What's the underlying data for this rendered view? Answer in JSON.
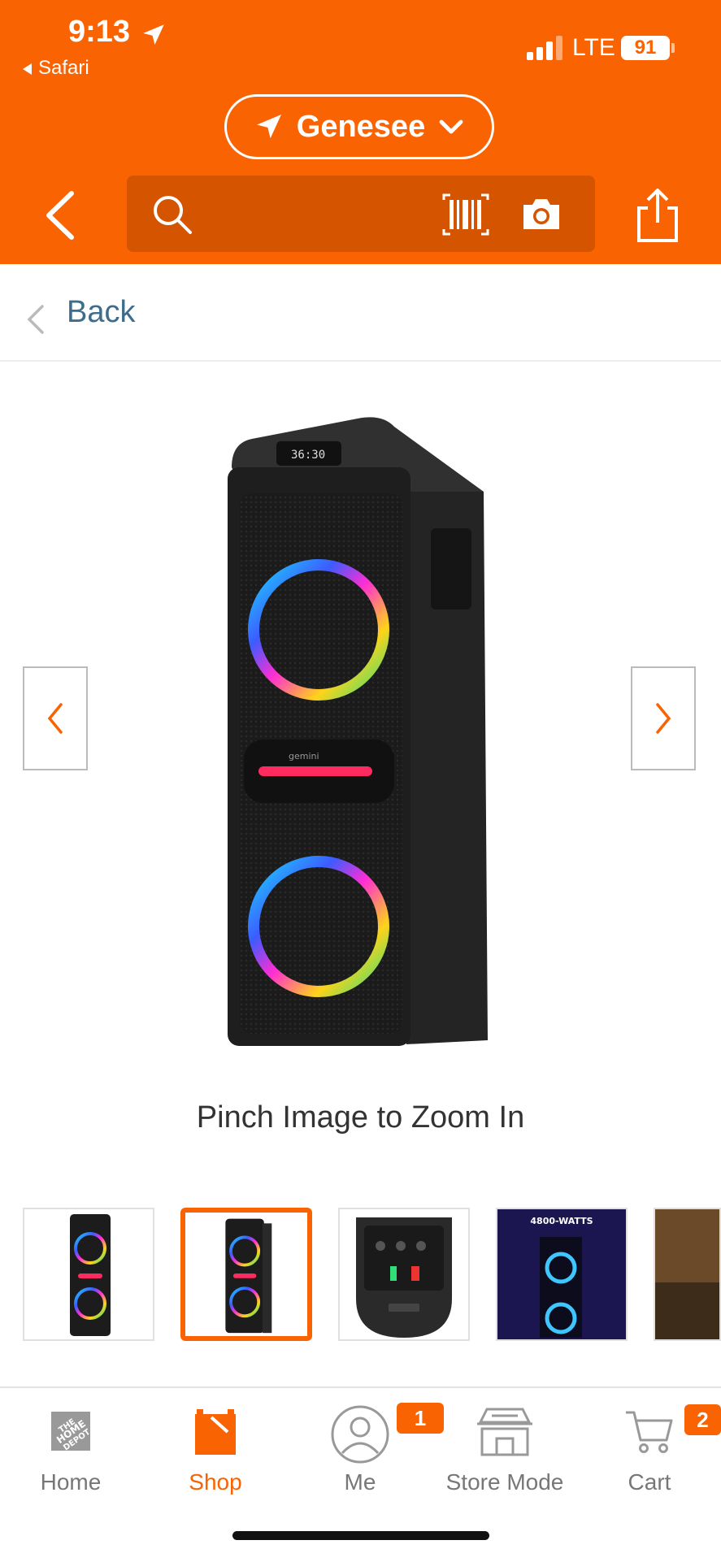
{
  "status_bar": {
    "time": "9:13",
    "back_app": "Safari",
    "network": "LTE",
    "battery": "91"
  },
  "header": {
    "store_name": "Genesee"
  },
  "backbar": {
    "label": "Back"
  },
  "gallery": {
    "hint": "Pinch Image to Zoom In",
    "active_thumbnail_index": 1,
    "thumbnail_count": 5
  },
  "thumbnails": [
    {
      "overlay_text": ""
    },
    {
      "overlay_text": ""
    },
    {
      "overlay_text": ""
    },
    {
      "overlay_text": "4800-WATTS"
    },
    {
      "overlay_text": ""
    }
  ],
  "tabbar": {
    "tabs": [
      {
        "label": "Home",
        "icon": "home-depot-logo-icon",
        "active": false
      },
      {
        "label": "Shop",
        "icon": "shop-bag-icon",
        "active": true
      },
      {
        "label": "Me",
        "icon": "user-icon",
        "active": false,
        "badge": "1"
      },
      {
        "label": "Store Mode",
        "icon": "store-icon",
        "active": false
      },
      {
        "label": "Cart",
        "icon": "cart-icon",
        "active": false,
        "badge": "2"
      }
    ]
  },
  "colors": {
    "brand": "#f96302",
    "header_dark": "#d55400",
    "link": "#3e6d8c"
  }
}
